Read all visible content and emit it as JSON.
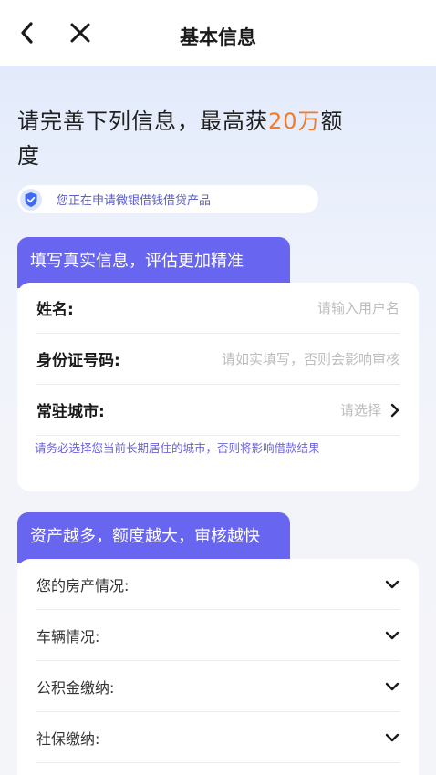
{
  "nav": {
    "title": "基本信息",
    "back_icon": "chevron-left-icon",
    "close_icon": "close-icon"
  },
  "headline": {
    "prefix": "请完善下列信息，最高获",
    "amount": "20万",
    "suffix": "额度",
    "amount_color": "#f27a2a"
  },
  "notice": {
    "icon": "shield-check-icon",
    "text": "您正在申请微银借钱借贷产品"
  },
  "section1": {
    "tab_label": "填写真实信息，评估更加精准",
    "fields": [
      {
        "label": "姓名:",
        "placeholder": "请输入用户名"
      },
      {
        "label": "身份证号码:",
        "placeholder": "请如实填写，否则会影响审核"
      },
      {
        "label": "常驻城市:",
        "placeholder": "请选择"
      }
    ],
    "hint": "请务必选择您当前长期居住的城市，否则将影响借款结果"
  },
  "section2": {
    "tab_label": "资产越多，额度越大，审核越快",
    "items": [
      {
        "label": "您的房产情况:"
      },
      {
        "label": "车辆情况:"
      },
      {
        "label": "公积金缴纳:"
      },
      {
        "label": "社保缴纳:"
      }
    ]
  },
  "colors": {
    "accent": "#6865f0",
    "highlight": "#f27a2a",
    "hint": "#6a63d8"
  }
}
